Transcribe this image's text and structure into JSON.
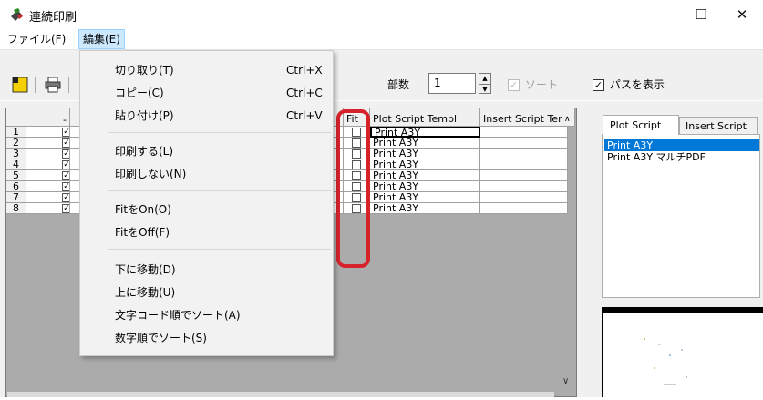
{
  "window": {
    "title": "連続印刷",
    "minimize": "—",
    "maximize": "☐",
    "close": "✕"
  },
  "menubar": {
    "file": "ファイル(F)",
    "edit": "編集(E)"
  },
  "toolbar": {
    "copies_label": "部数",
    "copies_value": "1",
    "sort_label": "ソート",
    "sort_checked": true,
    "sort_enabled": false,
    "show_path_label": "パスを表示",
    "show_path_checked": true
  },
  "edit_menu": {
    "items": [
      {
        "label": "切り取り(T)",
        "shortcut": "Ctrl+X"
      },
      {
        "label": "コピー(C)",
        "shortcut": "Ctrl+C"
      },
      {
        "label": "貼り付け(P)",
        "shortcut": "Ctrl+V"
      },
      {
        "label": "印刷する(L)",
        "shortcut": ""
      },
      {
        "label": "印刷しない(N)",
        "shortcut": ""
      },
      {
        "label": "FitをOn(O)",
        "shortcut": ""
      },
      {
        "label": "FitをOff(F)",
        "shortcut": ""
      },
      {
        "label": "下に移動(D)",
        "shortcut": ""
      },
      {
        "label": "上に移動(U)",
        "shortcut": ""
      },
      {
        "label": "文字コード順でソート(A)",
        "shortcut": ""
      },
      {
        "label": "数字順でソート(S)",
        "shortcut": ""
      }
    ]
  },
  "grid": {
    "headers": {
      "print": "-",
      "fit": "Fit",
      "plot_script": "Plot Script Templ",
      "insert_script": "Insert Script Ter"
    },
    "rows": [
      {
        "num": "1",
        "print": "✓",
        "fit": false,
        "plot": "Print A3Y"
      },
      {
        "num": "2",
        "print": "✓",
        "fit": false,
        "plot": "Print A3Y"
      },
      {
        "num": "3",
        "print": "✓",
        "fit": false,
        "plot": "Print A3Y"
      },
      {
        "num": "4",
        "print": "✓",
        "fit": false,
        "plot": "Print A3Y"
      },
      {
        "num": "5",
        "print": "✓",
        "fit": false,
        "plot": "Print A3Y"
      },
      {
        "num": "6",
        "print": "✓",
        "fit": false,
        "plot": "Print A3Y"
      },
      {
        "num": "7",
        "print": "✓",
        "fit": false,
        "plot": "Print A3Y"
      },
      {
        "num": "8",
        "print": "✓",
        "fit": false,
        "plot": "Print A3Y"
      }
    ]
  },
  "side_panel": {
    "tabs": [
      "Plot Script",
      "Insert Script"
    ],
    "active_tab": 0,
    "list": [
      "Print A3Y",
      "Print A3Y マルチPDF"
    ],
    "selected_index": 0
  },
  "colors": {
    "highlight": "#d6232b",
    "selection": "#0078d7",
    "menu_highlight": "#cce8ff"
  }
}
